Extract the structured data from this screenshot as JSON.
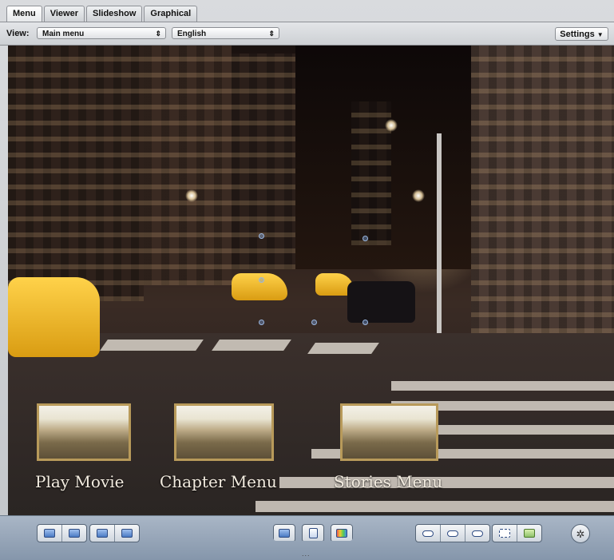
{
  "tabs": [
    {
      "label": "Menu",
      "active": true
    },
    {
      "label": "Viewer",
      "active": false
    },
    {
      "label": "Slideshow",
      "active": false
    },
    {
      "label": "Graphical",
      "active": false
    }
  ],
  "toolbar": {
    "view_label": "View:",
    "view_select": "Main menu",
    "language_select": "English",
    "settings_label": "Settings"
  },
  "menu_buttons": [
    {
      "label": "Play Movie"
    },
    {
      "label": "Chapter Menu"
    },
    {
      "label": "Stories Menu"
    }
  ],
  "bottom_bar": {
    "status": "...",
    "center_icons": [
      "folder-icon",
      "document-icon",
      "palette-icon"
    ],
    "circle_button_icon": "figure-icon"
  },
  "colors": {
    "window_bg": "#c9ccd0",
    "bottom_bar": "#93a3b6",
    "thumb_frame": "#b89a5a"
  }
}
